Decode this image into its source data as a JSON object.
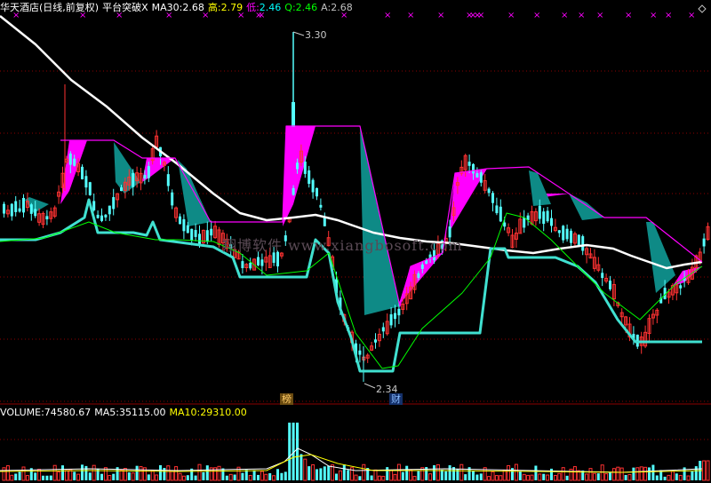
{
  "header": {
    "stock_title": "华天酒店(日线,前复权)",
    "indicator": "平台突破X",
    "ma30_label": "MA30:",
    "ma30_value": "2.68",
    "high_label": "高:",
    "high_value": "2.79",
    "low_label": "低:",
    "low_value": "2.46",
    "q_label": "Q:",
    "q_value": "2.46",
    "a_label": "A:",
    "a_value": "2.68"
  },
  "volume_header": {
    "volume_label": "VOLUME:",
    "volume_value": "74580.67",
    "ma5_label": "MA5:",
    "ma5_value": "35115.00",
    "ma10_label": "MA10:",
    "ma10_value": "29310.00"
  },
  "annotations": {
    "max_price": "3.30",
    "min_price": "2.34",
    "badge_bang": "榜",
    "badge_cai": "财"
  },
  "watermark": "翔博软件 www.xiangbosoft.com",
  "colors": {
    "background": "#000000",
    "up_candle": "#ff3232",
    "down_candle": "#54ffff",
    "ma30_line": "#ffffff",
    "high_line": "#ff00ff",
    "low_line": "#40e0d0",
    "q_line": "#00ff00",
    "magenta_fill": "#ff00ff",
    "teal_fill": "#0e8a86",
    "ma5": "#ffffff",
    "ma10": "#ffff00",
    "grid": "#8b0000"
  },
  "chart_data": [
    {
      "type": "candlestick",
      "title": "平台突破X",
      "yrange": [
        2.3,
        3.32
      ],
      "ma30_start": 3.25,
      "ma30_end": 2.68,
      "price_max": 3.3,
      "price_min": 2.34,
      "last": {
        "high": 2.79,
        "low": 2.46,
        "q": 2.46,
        "a": 2.68
      }
    },
    {
      "type": "bar",
      "title": "VOLUME",
      "volume": 74580.67,
      "ma5": 35115.0,
      "ma10": 29310.0
    }
  ]
}
